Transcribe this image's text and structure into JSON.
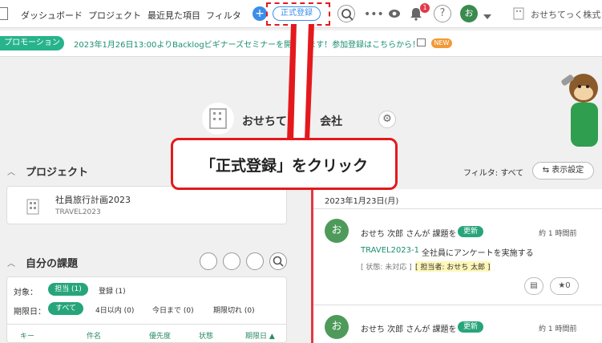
{
  "header": {
    "nav": [
      "ダッシュボード",
      "プロジェクト",
      "最近見た項目",
      "フィルタ"
    ],
    "register_label": "正式登録",
    "notification_count": "1",
    "avatar_initial": "お",
    "space_name": "おせちてっく株式"
  },
  "promo": {
    "tag": "プロモーション",
    "text": "2023年1月26日13:00よりBacklogビギナーズセミナーを開催します！参加登録はこちらから！",
    "new_badge": "NEW"
  },
  "space": {
    "title": "おせちてっ　　会社"
  },
  "projects": {
    "section_title": "プロジェクト",
    "items": [
      {
        "name": "社員旅行計画2023",
        "key": "TRAVEL2023"
      }
    ]
  },
  "my_issues": {
    "section_title": "自分の課題",
    "target_label": "対象：",
    "target_options": [
      "担当 (1)",
      "登録 (1)"
    ],
    "due_label": "期限日：",
    "due_options": [
      "すべて",
      "4日以内 (0)",
      "今日まで (0)",
      "期限切れ (0)"
    ],
    "columns": [
      "キー",
      "件名",
      "優先度",
      "状態",
      "期限日 ▲"
    ]
  },
  "activity": {
    "filter_text": "フィルタ: すべて",
    "display_settings": "表示設定",
    "date": "2023年1月23日(月)",
    "items": [
      {
        "avatar": "お",
        "text": "おせち 次郎 さんが 課題を",
        "badge": "更新",
        "time": "約 1 時間前",
        "issue_key": "TRAVEL2023-1",
        "issue_title": "全社員にアンケートを実施する",
        "status": "[ 状態: 未対応 ]",
        "assignee": "[ 担当者: おせち 太郎 ]",
        "star_count": "0"
      },
      {
        "avatar": "お",
        "text": "おせち 次郎 さんが 課題を",
        "badge": "更新",
        "time": "約 1 時間前"
      }
    ]
  },
  "annotation": {
    "callout_text": "「正式登録」をクリック"
  },
  "colors": {
    "accent_green": "#27a57a",
    "annotation_red": "#e4191c",
    "brand_blue": "#3b8ee8"
  }
}
